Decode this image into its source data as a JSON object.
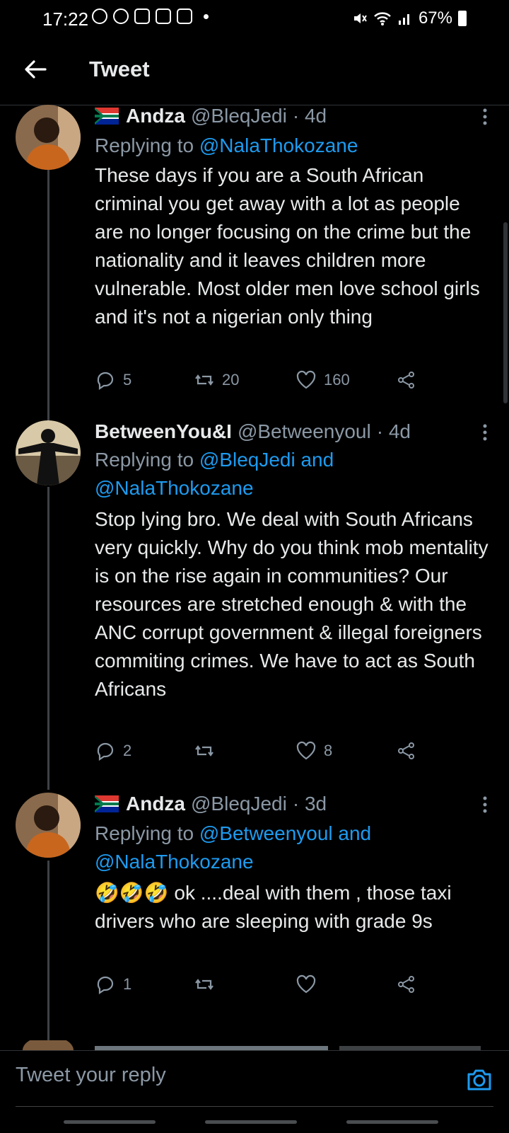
{
  "status_bar": {
    "time": "17:22",
    "battery": "67%"
  },
  "header": {
    "title": "Tweet"
  },
  "tweets": [
    {
      "name": "Andza",
      "handle": "@BleqJedi",
      "age": "· 4d",
      "replying_prefix": "Replying to",
      "mentions": "@NalaThokozane",
      "text": "These days if you are a South African criminal you get away with a lot as people are no longer focusing on the crime but the nationality and it leaves children more vulnerable. Most older men love school girls and it's not a nigerian only thing",
      "replies": "5",
      "retweets": "20",
      "likes": "160"
    },
    {
      "name": "BetweenYou&I",
      "handle": "@Betweenyoul",
      "age": "· 4d",
      "replying_prefix": "Replying to",
      "mentions": "@BleqJedi and @NalaThokozane",
      "text": "Stop lying bro. We deal with South Africans very quickly. Why do you think mob mentality is on the rise again in communities? Our resources are stretched enough & with the ANC corrupt government & illegal foreigners commiting crimes. We have to act as South Africans",
      "replies": "2",
      "retweets": "",
      "likes": "8"
    },
    {
      "name": "Andza",
      "handle": "@BleqJedi",
      "age": "· 3d",
      "replying_prefix": "Replying to",
      "mentions": "@Betweenyoul and @NalaThokozane",
      "text": "🤣🤣🤣 ok ....deal with them , those taxi drivers who are sleeping with grade 9s",
      "replies": "1",
      "retweets": "",
      "likes": ""
    }
  ],
  "reply_bar": {
    "placeholder": "Tweet your reply"
  }
}
